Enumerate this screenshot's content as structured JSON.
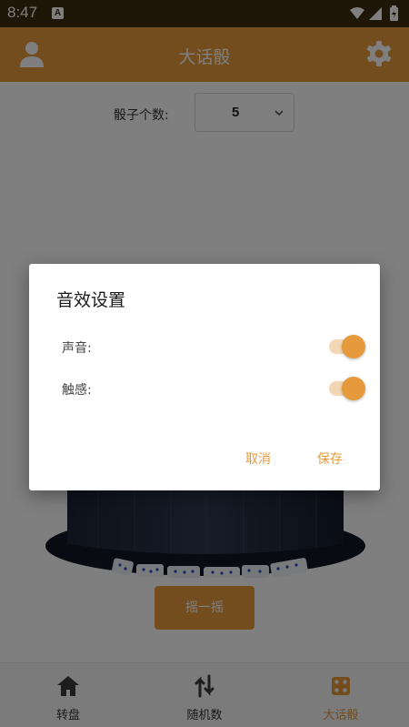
{
  "status_bar": {
    "time": "8:47",
    "notification_letter": "A"
  },
  "app_bar": {
    "title": "大话骰"
  },
  "dice_count": {
    "label": "骰子个数:",
    "value": "5"
  },
  "shake_button": {
    "label": "摇一摇"
  },
  "bottom_nav": {
    "items": [
      {
        "label": "转盘",
        "icon": "home-icon"
      },
      {
        "label": "随机数",
        "icon": "swap-icon"
      },
      {
        "label": "大话骰",
        "icon": "dice-icon"
      }
    ],
    "active_index": 2
  },
  "dialog": {
    "title": "音效设置",
    "sound": {
      "label": "声音:",
      "enabled": true
    },
    "haptics": {
      "label": "触感:",
      "enabled": true
    },
    "cancel_label": "取消",
    "save_label": "保存"
  },
  "colors": {
    "accent": "#e69a3c",
    "status_bar": "#3d2c0e",
    "switch_track": "#f3d7b4"
  }
}
